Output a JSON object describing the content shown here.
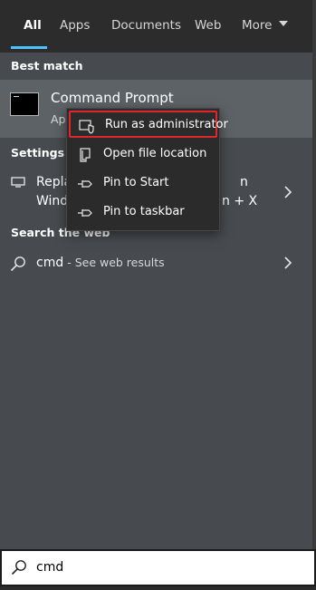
{
  "tabs": [
    {
      "label": "All",
      "active": true
    },
    {
      "label": "Apps"
    },
    {
      "label": "Documents"
    },
    {
      "label": "Web"
    },
    {
      "label": "More"
    }
  ],
  "sections": {
    "best_match": "Best match",
    "settings": "Settings",
    "search_web": "Search the web"
  },
  "best_match": {
    "title": "Command Prompt",
    "subtitle": "Ap"
  },
  "settings_item": {
    "line1_left": "Repla",
    "line1_right": "n",
    "line2_left": "Wind",
    "line2_right": "n + X"
  },
  "web_result": {
    "query": "cmd",
    "suffix": " - See web results"
  },
  "context_menu": {
    "items": [
      {
        "label": "Run as administrator",
        "icon": "shield-icon",
        "highlighted": true
      },
      {
        "label": "Open file location",
        "icon": "file-icon"
      },
      {
        "label": "Pin to Start",
        "icon": "pin-icon"
      },
      {
        "label": "Pin to taskbar",
        "icon": "pin-icon"
      }
    ]
  },
  "search": {
    "value": "cmd"
  },
  "colors": {
    "accent": "#4cc2ff",
    "highlight_border": "#e0252b"
  }
}
